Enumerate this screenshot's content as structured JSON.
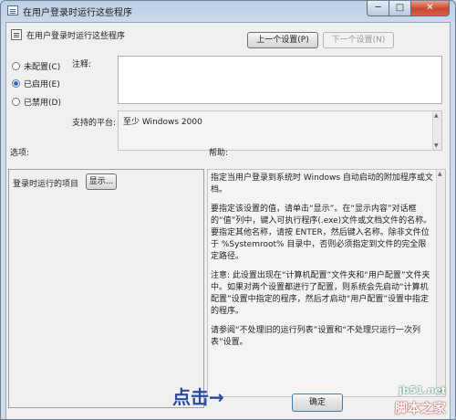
{
  "window": {
    "title": "在用户登录时运行这些程序",
    "minimize_glyph": "─",
    "maximize_glyph": "□",
    "close_glyph": "✕"
  },
  "header": {
    "policy_name": "在用户登录时运行这些程序",
    "prev_button": "上一个设置(P)",
    "next_button": "下一个设置(N)"
  },
  "state": {
    "options": [
      {
        "label": "未配置(C)",
        "checked": false
      },
      {
        "label": "已启用(E)",
        "checked": true
      },
      {
        "label": "已禁用(D)",
        "checked": false
      }
    ]
  },
  "comment": {
    "label": "注释:",
    "value": ""
  },
  "platform": {
    "label": "支持的平台:",
    "value": "至少 Windows 2000"
  },
  "options_panel": {
    "label": "选项:",
    "item_label": "登录时运行的项目",
    "show_button": "显示..."
  },
  "help_panel": {
    "label": "帮助:",
    "paragraphs": [
      "指定当用户登录到系统时 Windows 自动启动的附加程序或文档。",
      "要指定该设置的值，请单击“显示”。在“显示内容”对话框的“值”列中，键入可执行程序(.exe)文件或文档文件的名称。要指定其他名称，请按 ENTER，然后键入名称。除非文件位于 %Systemroot% 目录中，否则必须指定到文件的完全限定路径。",
      "注意: 此设置出现在“计算机配置”文件夹和“用户配置”文件夹中。如果对两个设置都进行了配置，则系统会先启动“计算机配置”设置中指定的程序，然后才启动“用户配置”设置中指定的程序。",
      "请参阅“不处理旧的运行列表”设置和“不处理只运行一次列表”设置。"
    ]
  },
  "footer": {
    "ok_button": "确定"
  },
  "overlay": {
    "annotation": "点击→",
    "watermark_site": "jb51.net",
    "watermark_name": "脚本之家"
  }
}
